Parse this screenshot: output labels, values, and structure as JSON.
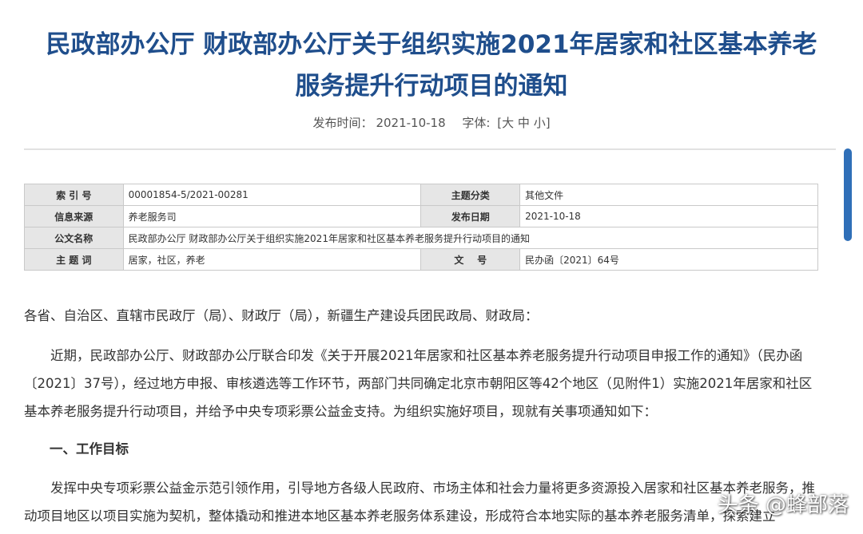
{
  "header": {
    "title_line1": "民政部办公厅 财政部办公厅关于组织实施2021年居家和社区基本养老",
    "title_line2": "服务提升行动项目的通知",
    "publish_label": "发布时间：",
    "publish_date": "2021-10-18",
    "font_label": "字体:",
    "font_sizes": [
      "[大",
      "中",
      "小]"
    ]
  },
  "info_table": {
    "rows": [
      {
        "label1": "索 引 号",
        "value1": "00001854-5/2021-00281",
        "label2": "主题分类",
        "value2": "其他文件"
      },
      {
        "label1": "信息来源",
        "value1": "养老服务司",
        "label2": "发布日期",
        "value2": "2021-10-18"
      },
      {
        "label1": "公文名称",
        "value1": "民政部办公厅 财政部办公厅关于组织实施2021年居家和社区基本养老服务提升行动项目的通知"
      },
      {
        "label1": "主 题 词",
        "value1": "居家，社区，养老",
        "label2": "文    号",
        "value2": "民办函〔2021〕64号"
      }
    ]
  },
  "body": {
    "salutation": "各省、自治区、直辖市民政厅（局）、财政厅（局），新疆生产建设兵团民政局、财政局：",
    "para1": "近期，民政部办公厅、财政部办公厅联合印发《关于开展2021年居家和社区基本养老服务提升行动项目申报工作的通知》（民办函〔2021〕37号），经过地方申报、审核遴选等工作环节，两部门共同确定北京市朝阳区等42个地区（见附件1）实施2021年居家和社区基本养老服务提升行动项目，并给予中央专项彩票公益金支持。为组织实施好项目，现就有关事项通知如下：",
    "section1_heading": "一、工作目标",
    "para2": "发挥中央专项彩票公益金示范引领作用，引导地方各级人民政府、市场主体和社会力量将更多资源投入居家和社区基本养老服务，推动项目地区以项目实施为契机，整体撬动和推进本地区基本养老服务体系建设，形成符合本地实际的基本养老服务清单，探索建立"
  },
  "watermark": "头条 @蜂部落",
  "colors": {
    "title": "#1f4e8c",
    "scrollbar": "#2f6fb8",
    "label_bg": "#e6e6e6"
  }
}
